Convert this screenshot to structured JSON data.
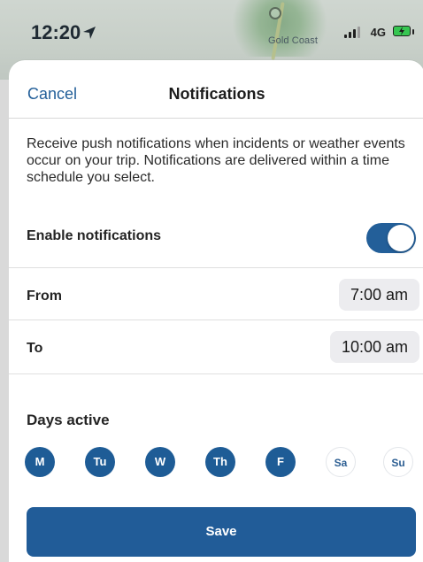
{
  "status_bar": {
    "time": "12:20",
    "network": "4G",
    "map_label": "Gold Coast"
  },
  "nav": {
    "cancel_label": "Cancel",
    "title": "Notifications"
  },
  "description": "Receive push notifications when incidents or weather events occur on your trip. Notifications are delivered within a time schedule you select.",
  "enable_notifications": {
    "label": "Enable notifications",
    "value": true
  },
  "schedule": {
    "from_label": "From",
    "from_value": "7:00 am",
    "to_label": "To",
    "to_value": "10:00 am"
  },
  "days": {
    "title": "Days active",
    "items": [
      {
        "label": "M",
        "active": true
      },
      {
        "label": "Tu",
        "active": true
      },
      {
        "label": "W",
        "active": true
      },
      {
        "label": "Th",
        "active": true
      },
      {
        "label": "F",
        "active": true
      },
      {
        "label": "Sa",
        "active": false
      },
      {
        "label": "Su",
        "active": false
      }
    ]
  },
  "save_label": "Save",
  "colors": {
    "accent": "#215c98",
    "toggle_on": "#235f99",
    "battery": "#36c651"
  }
}
